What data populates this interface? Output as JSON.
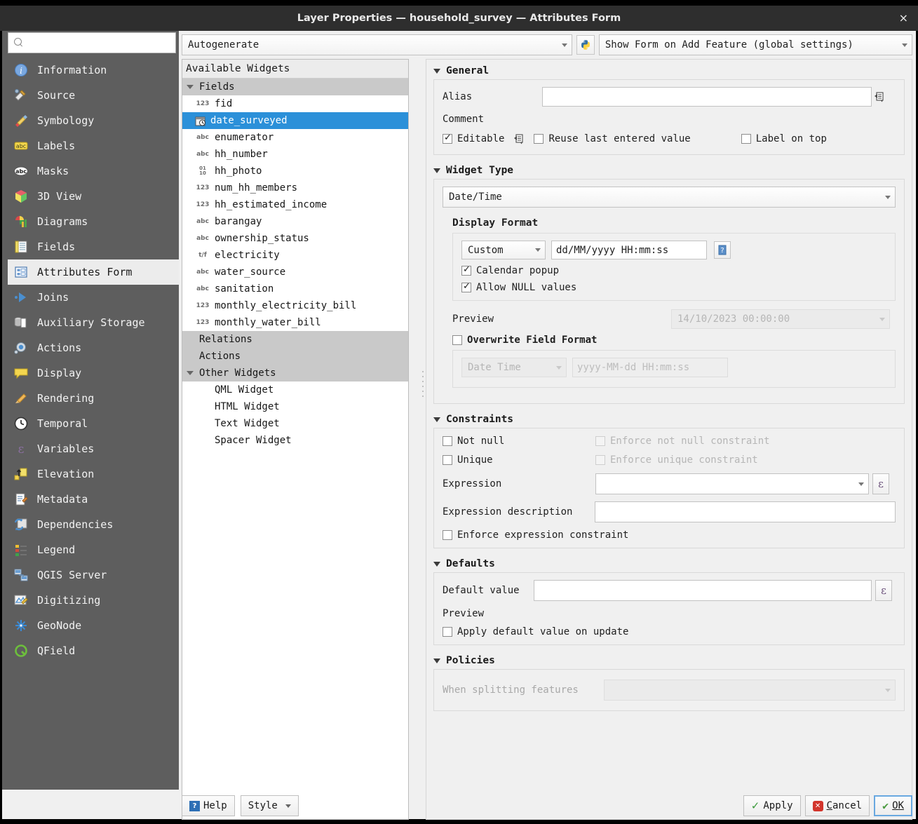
{
  "window": {
    "title": "Layer Properties — household_survey — Attributes Form",
    "close_label": "×"
  },
  "sidebar": {
    "search_placeholder": "",
    "search_value": "",
    "items": [
      {
        "label": "Information",
        "icon": "info-icon",
        "selected": false
      },
      {
        "label": "Source",
        "icon": "source-icon",
        "selected": false
      },
      {
        "label": "Symbology",
        "icon": "symbology-icon",
        "selected": false
      },
      {
        "label": "Labels",
        "icon": "labels-icon",
        "selected": false
      },
      {
        "label": "Masks",
        "icon": "masks-icon",
        "selected": false
      },
      {
        "label": "3D View",
        "icon": "cube-icon",
        "selected": false
      },
      {
        "label": "Diagrams",
        "icon": "diagrams-icon",
        "selected": false
      },
      {
        "label": "Fields",
        "icon": "fields-icon",
        "selected": false
      },
      {
        "label": "Attributes Form",
        "icon": "attributes-form-icon",
        "selected": true
      },
      {
        "label": "Joins",
        "icon": "joins-icon",
        "selected": false
      },
      {
        "label": "Auxiliary Storage",
        "icon": "auxiliary-storage-icon",
        "selected": false
      },
      {
        "label": "Actions",
        "icon": "actions-gear-icon",
        "selected": false
      },
      {
        "label": "Display",
        "icon": "display-balloon-icon",
        "selected": false
      },
      {
        "label": "Rendering",
        "icon": "rendering-brush-icon",
        "selected": false
      },
      {
        "label": "Temporal",
        "icon": "clock-icon",
        "selected": false
      },
      {
        "label": "Variables",
        "icon": "variables-epsilon-icon",
        "selected": false
      },
      {
        "label": "Elevation",
        "icon": "elevation-arrow-icon",
        "selected": false
      },
      {
        "label": "Metadata",
        "icon": "metadata-pencil-icon",
        "selected": false
      },
      {
        "label": "Dependencies",
        "icon": "dependencies-icon",
        "selected": false
      },
      {
        "label": "Legend",
        "icon": "legend-icon",
        "selected": false
      },
      {
        "label": "QGIS Server",
        "icon": "qgis-server-icon",
        "selected": false
      },
      {
        "label": "Digitizing",
        "icon": "digitizing-icon",
        "selected": false
      },
      {
        "label": "GeoNode",
        "icon": "geonode-icon",
        "selected": false
      },
      {
        "label": "QField",
        "icon": "qfield-icon",
        "selected": false
      }
    ]
  },
  "toolbar": {
    "layout_combo_value": "Autogenerate",
    "python_icon": "python-icon",
    "show_form_combo_value": "Show Form on Add Feature (global settings)"
  },
  "tree": {
    "header": "Available Widgets",
    "rows": [
      {
        "label": "Fields",
        "kind": "group",
        "arrow": true,
        "indent": 0
      },
      {
        "label": "fid",
        "kind": "field",
        "type_icon": "123"
      },
      {
        "label": "date_surveyed",
        "kind": "field",
        "type_icon": "calendar-clock-icon",
        "selected": true
      },
      {
        "label": "enumerator",
        "kind": "field",
        "type_icon": "abc"
      },
      {
        "label": "hh_number",
        "kind": "field",
        "type_icon": "abc"
      },
      {
        "label": "hh_photo",
        "kind": "field",
        "type_icon": "01/10"
      },
      {
        "label": "num_hh_members",
        "kind": "field",
        "type_icon": "123"
      },
      {
        "label": "hh_estimated_income",
        "kind": "field",
        "type_icon": "123"
      },
      {
        "label": "barangay",
        "kind": "field",
        "type_icon": "abc"
      },
      {
        "label": "ownership_status",
        "kind": "field",
        "type_icon": "abc"
      },
      {
        "label": "electricity",
        "kind": "field",
        "type_icon": "t/f"
      },
      {
        "label": "water_source",
        "kind": "field",
        "type_icon": "abc"
      },
      {
        "label": "sanitation",
        "kind": "field",
        "type_icon": "abc"
      },
      {
        "label": "monthly_electricity_bill",
        "kind": "field",
        "type_icon": "123"
      },
      {
        "label": "monthly_water_bill",
        "kind": "field",
        "type_icon": "123"
      },
      {
        "label": "Relations",
        "kind": "group",
        "arrow": false
      },
      {
        "label": "Actions",
        "kind": "group",
        "arrow": false
      },
      {
        "label": "Other Widgets",
        "kind": "group",
        "arrow": true
      },
      {
        "label": "QML Widget",
        "kind": "widget"
      },
      {
        "label": "HTML Widget",
        "kind": "widget"
      },
      {
        "label": "Text Widget",
        "kind": "widget"
      },
      {
        "label": "Spacer Widget",
        "kind": "widget"
      }
    ]
  },
  "general": {
    "title": "General",
    "alias_label": "Alias",
    "alias_value": "",
    "alias_override_icon": "data-defined-override-icon",
    "comment_label": "Comment",
    "editable_label": "Editable",
    "editable_checked": true,
    "editable_override_icon": "data-defined-override-icon",
    "reuse_label": "Reuse last entered value",
    "reuse_checked": false,
    "label_on_top_label": "Label on top",
    "label_on_top_checked": false
  },
  "widget_type": {
    "title": "Widget Type",
    "type_value": "Date/Time",
    "display_format_label": "Display Format",
    "format_mode_value": "Custom",
    "format_string_value": "dd/MM/yyyy HH:mm:ss",
    "format_help_icon": "info-help-icon",
    "calendar_popup_label": "Calendar popup",
    "calendar_popup_checked": true,
    "allow_null_label": "Allow NULL values",
    "allow_null_checked": true,
    "preview_label": "Preview",
    "preview_value": "14/10/2023 00:00:00",
    "overwrite_label": "Overwrite Field Format",
    "overwrite_checked": false,
    "overwrite_type_value": "Date Time",
    "overwrite_format_value": "yyyy-MM-dd HH:mm:ss"
  },
  "constraints": {
    "title": "Constraints",
    "not_null_label": "Not null",
    "not_null_checked": false,
    "enforce_not_null_label": "Enforce not null constraint",
    "enforce_not_null_checked": false,
    "unique_label": "Unique",
    "unique_checked": false,
    "enforce_unique_label": "Enforce unique constraint",
    "enforce_unique_checked": false,
    "expression_label": "Expression",
    "expression_value": "",
    "expression_builder_icon": "epsilon-icon",
    "expression_desc_label": "Expression description",
    "expression_desc_value": "",
    "enforce_expression_label": "Enforce expression constraint",
    "enforce_expression_checked": false
  },
  "defaults": {
    "title": "Defaults",
    "default_value_label": "Default value",
    "default_value": "",
    "default_builder_icon": "epsilon-icon",
    "preview_label": "Preview",
    "apply_on_update_label": "Apply default value on update",
    "apply_on_update_checked": false
  },
  "policies": {
    "title": "Policies",
    "when_splitting_label": "When splitting features",
    "when_splitting_value": ""
  },
  "buttons": {
    "help": "Help",
    "style": "Style",
    "apply": "Apply",
    "cancel": "Cancel",
    "ok": "OK"
  },
  "colors": {
    "selection_blue": "#2b90d9",
    "sidebar_bg": "#5e5e5e",
    "titlebar_bg": "#2e2e2e",
    "panel_bg": "#f0f0f0"
  }
}
